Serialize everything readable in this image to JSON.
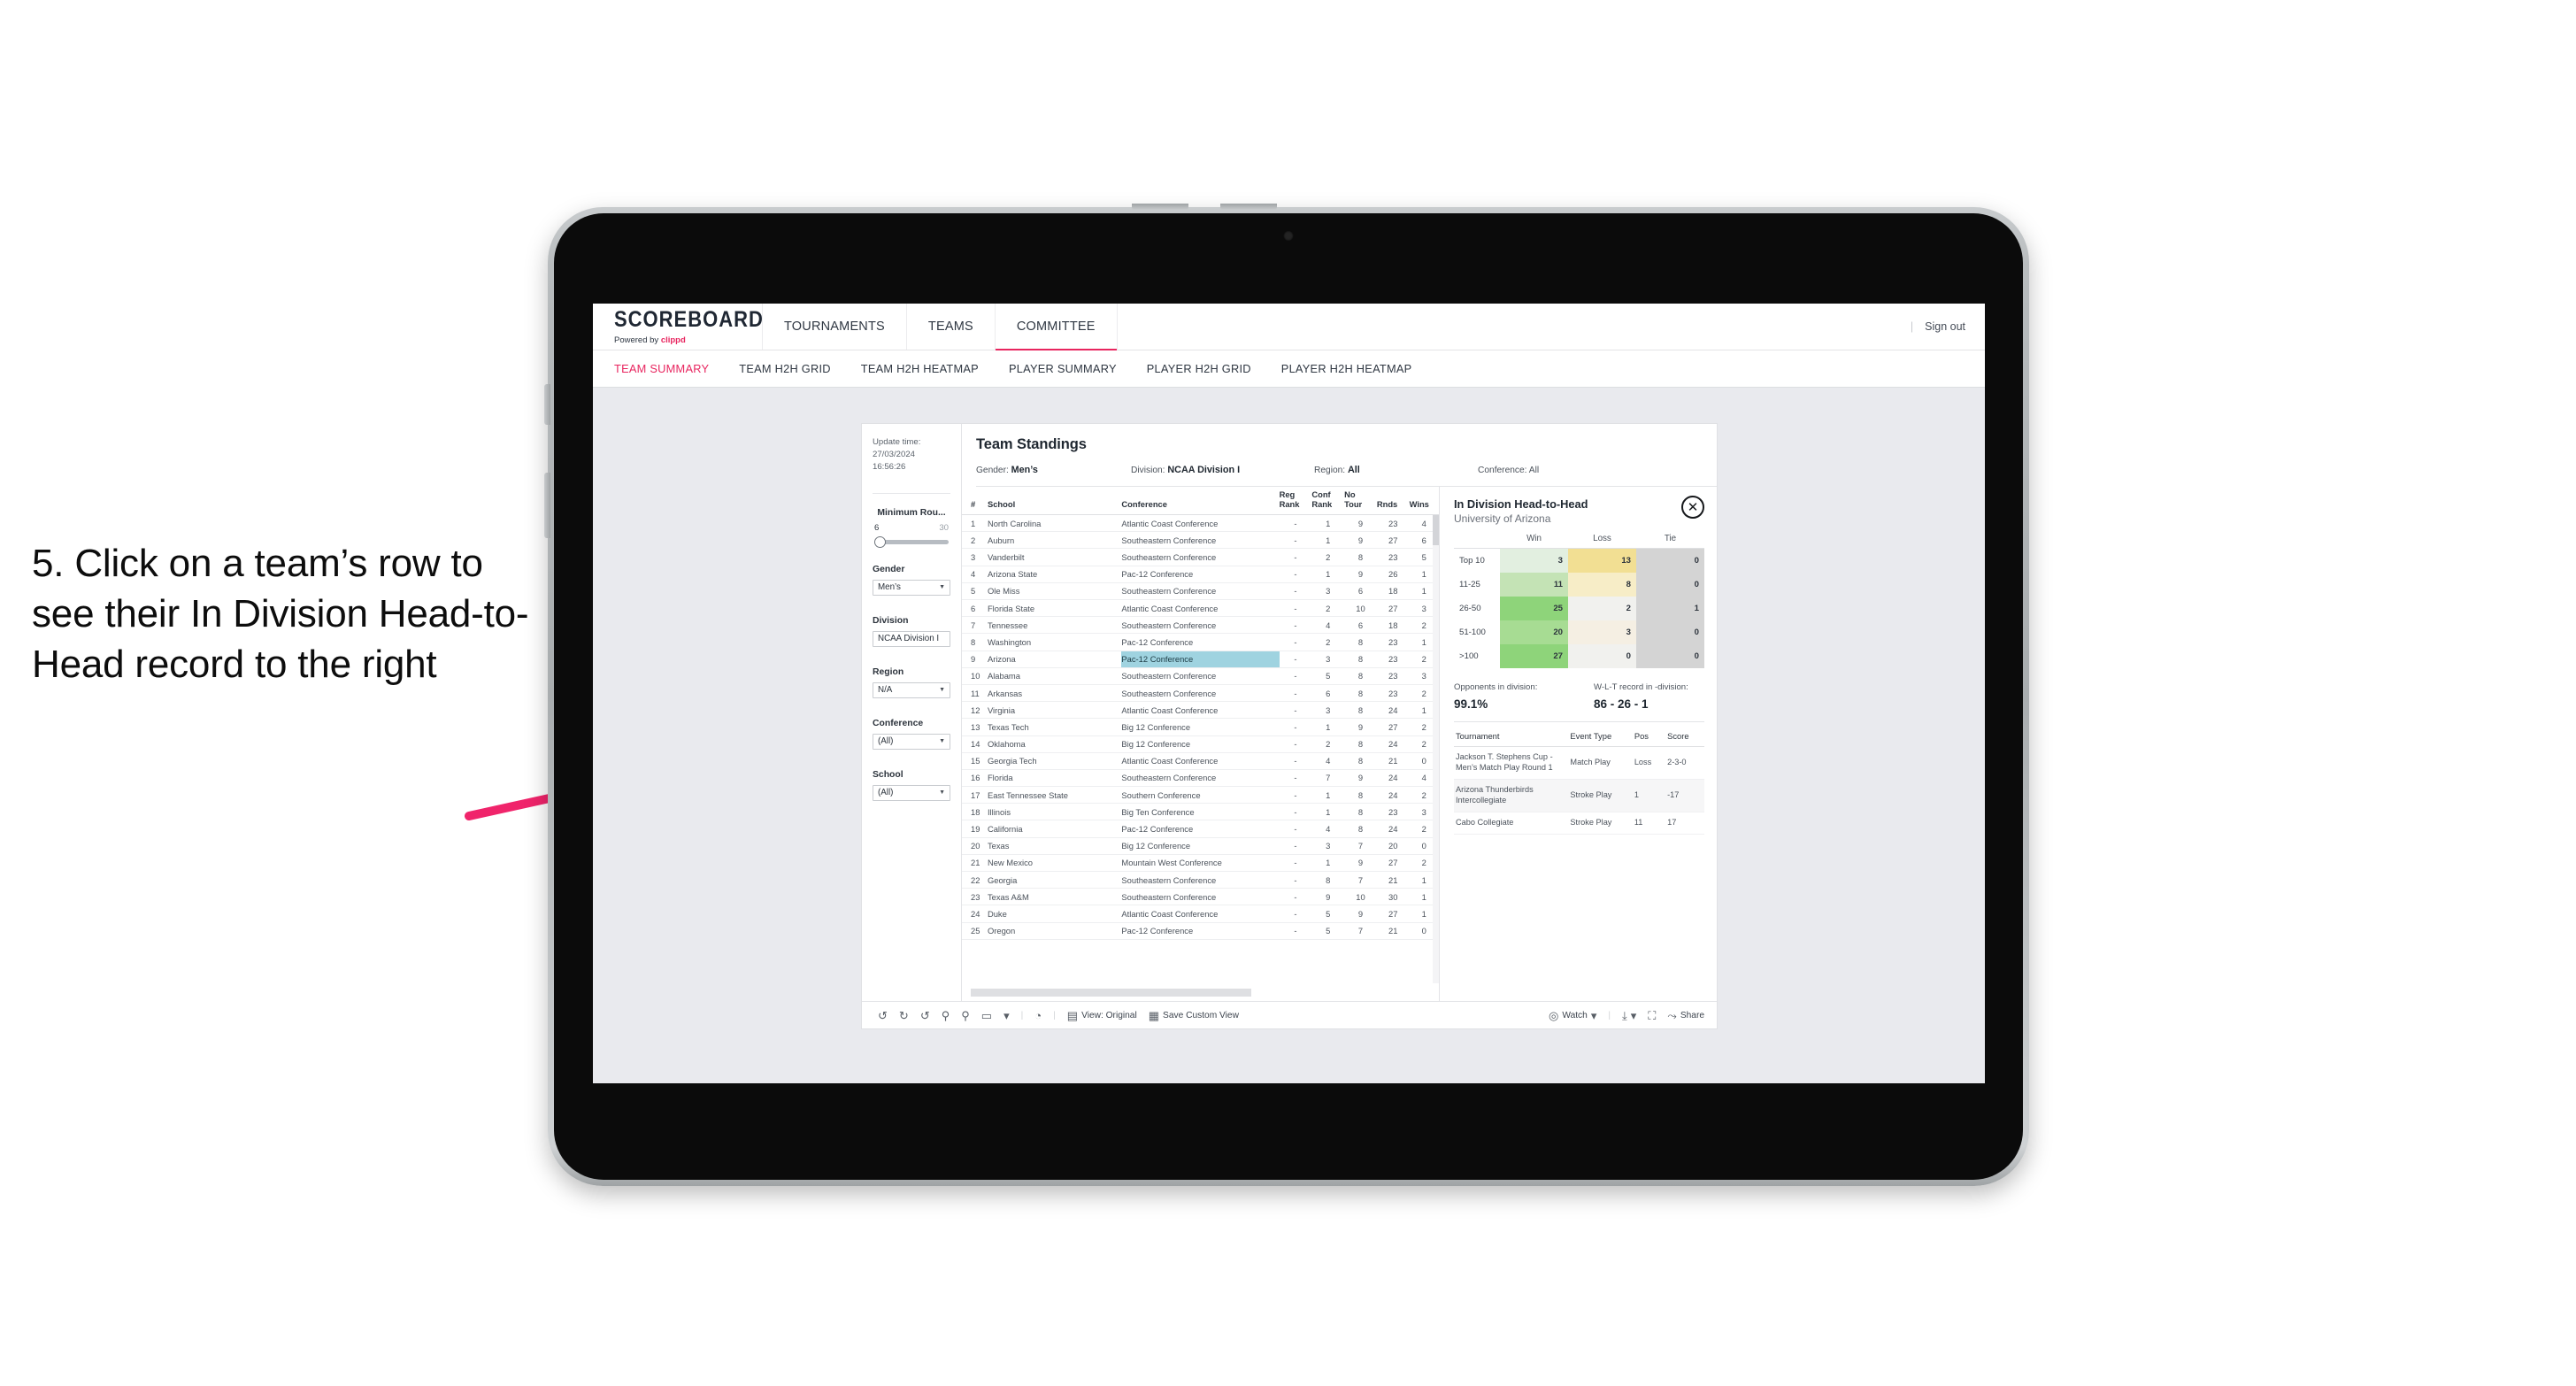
{
  "caption": "5. Click on a team’s row to see their In Division Head-to-Head record to the right",
  "brand": {
    "title": "SCOREBOARD",
    "powered_prefix": "Powered by ",
    "powered_name": "clippd"
  },
  "topnav": {
    "items": [
      "TOURNAMENTS",
      "TEAMS",
      "COMMITTEE"
    ],
    "active": "COMMITTEE",
    "divider": "|",
    "sign_out": "Sign out"
  },
  "subtabs": {
    "items": [
      "TEAM SUMMARY",
      "TEAM H2H GRID",
      "TEAM H2H HEATMAP",
      "PLAYER SUMMARY",
      "PLAYER H2H GRID",
      "PLAYER H2H HEATMAP"
    ],
    "active": "TEAM SUMMARY"
  },
  "filters": {
    "update_label": "Update time:",
    "update_value": "27/03/2024 16:56:26",
    "min_rounds": {
      "title": "Minimum Rou...",
      "low": "6",
      "high": "30"
    },
    "gender": {
      "title": "Gender",
      "value": "Men’s"
    },
    "division": {
      "title": "Division",
      "value": "NCAA Division I"
    },
    "region": {
      "title": "Region",
      "value": "N/A"
    },
    "conference": {
      "title": "Conference",
      "value": "(All)"
    },
    "school": {
      "title": "School",
      "value": "(All)"
    }
  },
  "standings": {
    "title": "Team Standings",
    "meta": [
      {
        "label": "Gender:",
        "value": "Men’s"
      },
      {
        "label": "Division:",
        "value": "NCAA Division I"
      },
      {
        "label": "Region:",
        "value": "All"
      },
      {
        "label": "Conference:",
        "value": "All"
      }
    ],
    "columns": [
      "#",
      "School",
      "Conference",
      "Reg Rank",
      "Conf Rank",
      "No Tour",
      "Rnds",
      "Wins"
    ],
    "columns_split": [
      {
        "l1": "#",
        "l2": ""
      },
      {
        "l1": "School",
        "l2": ""
      },
      {
        "l1": "Conference",
        "l2": ""
      },
      {
        "l1": "Reg",
        "l2": "Rank"
      },
      {
        "l1": "Conf",
        "l2": "Rank"
      },
      {
        "l1": "No",
        "l2": "Tour"
      },
      {
        "l1": "Rnds",
        "l2": ""
      },
      {
        "l1": "Wins",
        "l2": ""
      }
    ],
    "highlight_row_index": 8,
    "rows": [
      {
        "num": "1",
        "school": "North Carolina",
        "conference": "Atlantic Coast Conference",
        "reg": "-",
        "conf": "1",
        "notour": "9",
        "rnds": "23",
        "wins": "4"
      },
      {
        "num": "2",
        "school": "Auburn",
        "conference": "Southeastern Conference",
        "reg": "-",
        "conf": "1",
        "notour": "9",
        "rnds": "27",
        "wins": "6"
      },
      {
        "num": "3",
        "school": "Vanderbilt",
        "conference": "Southeastern Conference",
        "reg": "-",
        "conf": "2",
        "notour": "8",
        "rnds": "23",
        "wins": "5"
      },
      {
        "num": "4",
        "school": "Arizona State",
        "conference": "Pac-12 Conference",
        "reg": "-",
        "conf": "1",
        "notour": "9",
        "rnds": "26",
        "wins": "1"
      },
      {
        "num": "5",
        "school": "Ole Miss",
        "conference": "Southeastern Conference",
        "reg": "-",
        "conf": "3",
        "notour": "6",
        "rnds": "18",
        "wins": "1"
      },
      {
        "num": "6",
        "school": "Florida State",
        "conference": "Atlantic Coast Conference",
        "reg": "-",
        "conf": "2",
        "notour": "10",
        "rnds": "27",
        "wins": "3"
      },
      {
        "num": "7",
        "school": "Tennessee",
        "conference": "Southeastern Conference",
        "reg": "-",
        "conf": "4",
        "notour": "6",
        "rnds": "18",
        "wins": "2"
      },
      {
        "num": "8",
        "school": "Washington",
        "conference": "Pac-12 Conference",
        "reg": "-",
        "conf": "2",
        "notour": "8",
        "rnds": "23",
        "wins": "1"
      },
      {
        "num": "9",
        "school": "Arizona",
        "conference": "Pac-12 Conference",
        "reg": "-",
        "conf": "3",
        "notour": "8",
        "rnds": "23",
        "wins": "2"
      },
      {
        "num": "10",
        "school": "Alabama",
        "conference": "Southeastern Conference",
        "reg": "-",
        "conf": "5",
        "notour": "8",
        "rnds": "23",
        "wins": "3"
      },
      {
        "num": "11",
        "school": "Arkansas",
        "conference": "Southeastern Conference",
        "reg": "-",
        "conf": "6",
        "notour": "8",
        "rnds": "23",
        "wins": "2"
      },
      {
        "num": "12",
        "school": "Virginia",
        "conference": "Atlantic Coast Conference",
        "reg": "-",
        "conf": "3",
        "notour": "8",
        "rnds": "24",
        "wins": "1"
      },
      {
        "num": "13",
        "school": "Texas Tech",
        "conference": "Big 12 Conference",
        "reg": "-",
        "conf": "1",
        "notour": "9",
        "rnds": "27",
        "wins": "2"
      },
      {
        "num": "14",
        "school": "Oklahoma",
        "conference": "Big 12 Conference",
        "reg": "-",
        "conf": "2",
        "notour": "8",
        "rnds": "24",
        "wins": "2"
      },
      {
        "num": "15",
        "school": "Georgia Tech",
        "conference": "Atlantic Coast Conference",
        "reg": "-",
        "conf": "4",
        "notour": "8",
        "rnds": "21",
        "wins": "0"
      },
      {
        "num": "16",
        "school": "Florida",
        "conference": "Southeastern Conference",
        "reg": "-",
        "conf": "7",
        "notour": "9",
        "rnds": "24",
        "wins": "4"
      },
      {
        "num": "17",
        "school": "East Tennessee State",
        "conference": "Southern Conference",
        "reg": "-",
        "conf": "1",
        "notour": "8",
        "rnds": "24",
        "wins": "2"
      },
      {
        "num": "18",
        "school": "Illinois",
        "conference": "Big Ten Conference",
        "reg": "-",
        "conf": "1",
        "notour": "8",
        "rnds": "23",
        "wins": "3"
      },
      {
        "num": "19",
        "school": "California",
        "conference": "Pac-12 Conference",
        "reg": "-",
        "conf": "4",
        "notour": "8",
        "rnds": "24",
        "wins": "2"
      },
      {
        "num": "20",
        "school": "Texas",
        "conference": "Big 12 Conference",
        "reg": "-",
        "conf": "3",
        "notour": "7",
        "rnds": "20",
        "wins": "0"
      },
      {
        "num": "21",
        "school": "New Mexico",
        "conference": "Mountain West Conference",
        "reg": "-",
        "conf": "1",
        "notour": "9",
        "rnds": "27",
        "wins": "2"
      },
      {
        "num": "22",
        "school": "Georgia",
        "conference": "Southeastern Conference",
        "reg": "-",
        "conf": "8",
        "notour": "7",
        "rnds": "21",
        "wins": "1"
      },
      {
        "num": "23",
        "school": "Texas A&M",
        "conference": "Southeastern Conference",
        "reg": "-",
        "conf": "9",
        "notour": "10",
        "rnds": "30",
        "wins": "1"
      },
      {
        "num": "24",
        "school": "Duke",
        "conference": "Atlantic Coast Conference",
        "reg": "-",
        "conf": "5",
        "notour": "9",
        "rnds": "27",
        "wins": "1"
      },
      {
        "num": "25",
        "school": "Oregon",
        "conference": "Pac-12 Conference",
        "reg": "-",
        "conf": "5",
        "notour": "7",
        "rnds": "21",
        "wins": "0"
      }
    ]
  },
  "h2h": {
    "title": "In Division Head-to-Head",
    "subtitle": "University of Arizona",
    "close_label": "✕",
    "columns": [
      "Win",
      "Loss",
      "Tie"
    ],
    "rows": [
      {
        "bucket": "Top 10",
        "win": "3",
        "loss": "13",
        "tie": "0",
        "win_color": "#e2efe0",
        "loss_color": "#f2df93",
        "tie_color": "#d4d4d4"
      },
      {
        "bucket": "11-25",
        "win": "11",
        "loss": "8",
        "tie": "0",
        "win_color": "#c4e3b5",
        "loss_color": "#f7edc7",
        "tie_color": "#d4d4d4"
      },
      {
        "bucket": "26-50",
        "win": "25",
        "loss": "2",
        "tie": "1",
        "win_color": "#8ed47a",
        "loss_color": "#f1f1ee",
        "tie_color": "#d4d4d4"
      },
      {
        "bucket": "51-100",
        "win": "20",
        "loss": "3",
        "tie": "0",
        "win_color": "#a7dc93",
        "loss_color": "#f5efe3",
        "tie_color": "#d4d4d4"
      },
      {
        "bucket": ">100",
        "win": "27",
        "loss": "0",
        "tie": "0",
        "win_color": "#8ed47a",
        "loss_color": "#f1f1ee",
        "tie_color": "#d4d4d4"
      }
    ],
    "summary": [
      {
        "label": "Opponents in division:",
        "value": "99.1%"
      },
      {
        "label": "W-L-T record in -division:",
        "value": "86 - 26 - 1"
      }
    ],
    "tournaments": {
      "columns": [
        "Tournament",
        "Event Type",
        "Pos",
        "Score"
      ],
      "rows": [
        {
          "name": "Jackson T. Stephens Cup - Men’s Match Play Round 1",
          "type": "Match Play",
          "pos": "Loss",
          "score": "2-3-0"
        },
        {
          "name": "Arizona Thunderbirds Intercollegiate",
          "type": "Stroke Play",
          "pos": "1",
          "score": "-17"
        },
        {
          "name": "Cabo Collegiate",
          "type": "Stroke Play",
          "pos": "11",
          "score": "17"
        }
      ]
    }
  },
  "toolbar": {
    "undo_icon": "↺",
    "redo_icon": "↻",
    "revert_icon": "↺",
    "refresh_icon": "⚲",
    "pause_icon": "⚲",
    "shape_icon": "▭",
    "caret_icon": "▾",
    "sep": "|",
    "clock_icon": "◔",
    "view_icon": "▤",
    "view_label": "View: Original",
    "save_icon": "▦",
    "save_label": "Save Custom View",
    "watch_icon": "◎",
    "watch_label": "Watch",
    "watch_caret": "▾",
    "download_icon": "⤓",
    "download_caret": "▾",
    "fullscreen_icon": "⛶",
    "share_icon": "⤳",
    "share_label": "Share"
  },
  "colors": {
    "accent": "#e8255f",
    "highlight_row": "#9fd3e0",
    "canvas": "#e9eaee"
  }
}
